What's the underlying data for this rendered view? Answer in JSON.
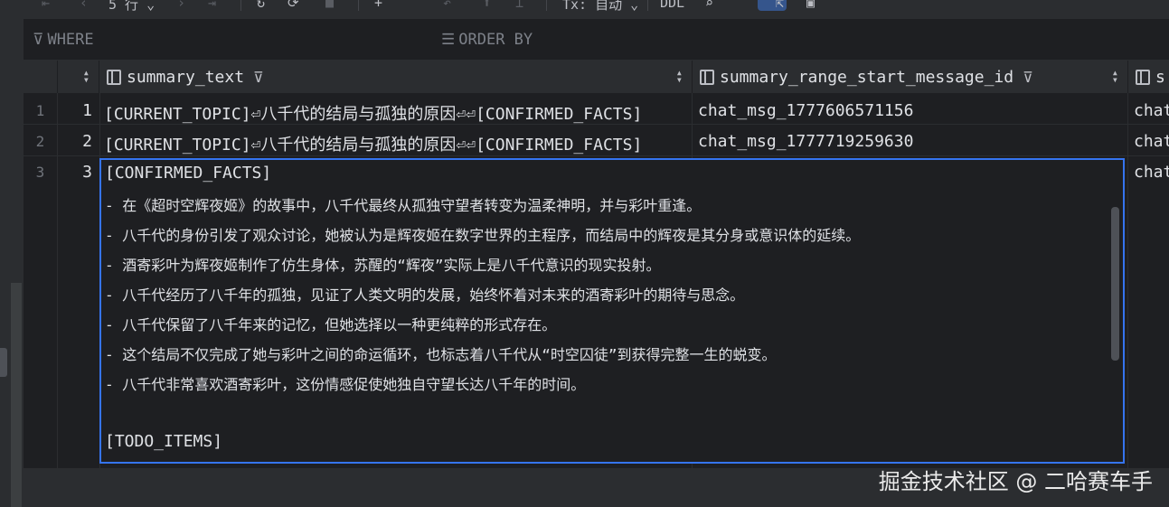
{
  "toolbar": {
    "page_size": "5 行",
    "tx_mode": "Tx: 自动",
    "ddl": "DDL"
  },
  "filter": {
    "where_label": "WHERE",
    "order_label": "ORDER BY"
  },
  "columns": [
    {
      "label": "summary_text"
    },
    {
      "label": "summary_range_start_message_id"
    },
    {
      "label": "s"
    }
  ],
  "rows": [
    {
      "index": "1",
      "number": "1",
      "summary_text": "[CURRENT_TOPIC]⏎八千代的结局与孤独的原因⏎⏎[CONFIRMED_FACTS]",
      "start_id": "chat_msg_1777606571156",
      "next": "chat"
    },
    {
      "index": "2",
      "number": "2",
      "summary_text": "[CURRENT_TOPIC]⏎八千代的结局与孤独的原因⏎⏎[CONFIRMED_FACTS]",
      "start_id": "chat_msg_1777719259630",
      "next": "chat"
    },
    {
      "index": "3",
      "number": "3",
      "next": "chat"
    }
  ],
  "editor": {
    "lines": [
      "[CONFIRMED_FACTS]",
      "- 在《超时空辉夜姬》的故事中，八千代最终从孤独守望者转变为温柔神明，并与彩叶重逢。",
      "- 八千代的身份引发了观众讨论，她被认为是辉夜姬在数字世界的主程序，而结局中的辉夜是其分身或意识体的延续。",
      "- 酒寄彩叶为辉夜姬制作了仿生身体，苏醒的“辉夜”实际上是八千代意识的现实投射。",
      "- 八千代经历了八千年的孤独，见证了人类文明的发展，始终怀着对未来的酒寄彩叶的期待与思念。",
      "- 八千代保留了八千年来的记忆，但她选择以一种更纯粹的形式存在。",
      "- 这个结局不仅完成了她与彩叶之间的命运循环，也标志着八千代从“时空囚徒”到获得完整一生的蜕变。",
      "- 八千代非常喜欢酒寄彩叶，这份情感促使她独自守望长达八千年的时间。",
      "",
      "[TODO_ITEMS]"
    ]
  },
  "watermark": "掘金技术社区 @ 二哈赛车手"
}
